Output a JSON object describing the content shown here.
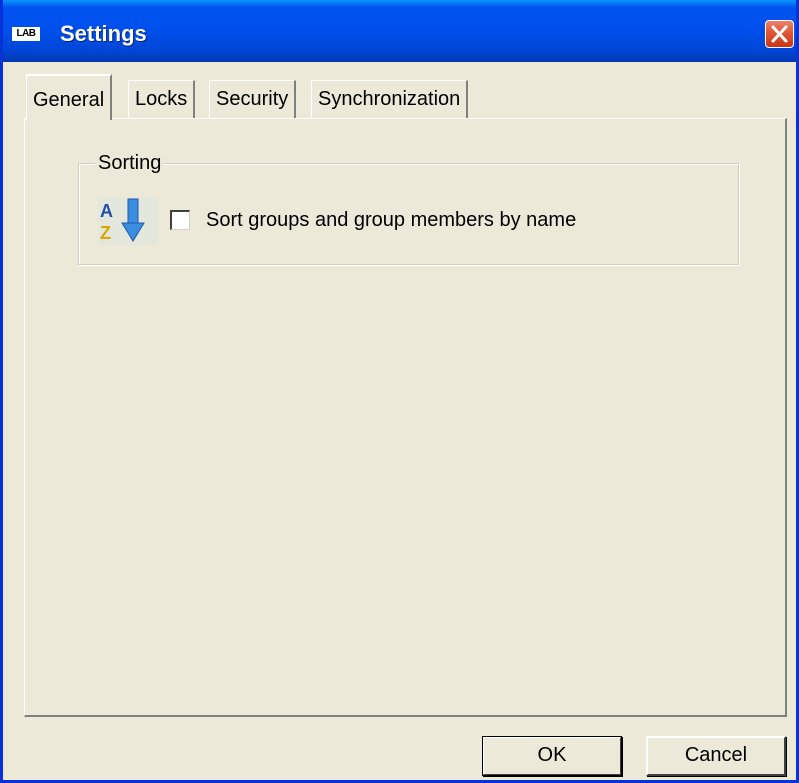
{
  "window": {
    "title": "Settings",
    "logo_text": "LAB",
    "close_icon": "close-icon"
  },
  "tabs": [
    {
      "label": "General",
      "active": true
    },
    {
      "label": "Locks",
      "active": false
    },
    {
      "label": "Security",
      "active": false
    },
    {
      "label": "Synchronization",
      "active": false
    }
  ],
  "general": {
    "sorting_group": {
      "title": "Sorting",
      "icon": "sort-az-icon",
      "checkbox_label": "Sort groups and group members by name",
      "checked": false
    }
  },
  "buttons": {
    "ok_label": "OK",
    "cancel_label": "Cancel"
  },
  "colors": {
    "titlebar": "#0053EE",
    "face": "#ECE9D8",
    "close": "#E25A3A"
  }
}
